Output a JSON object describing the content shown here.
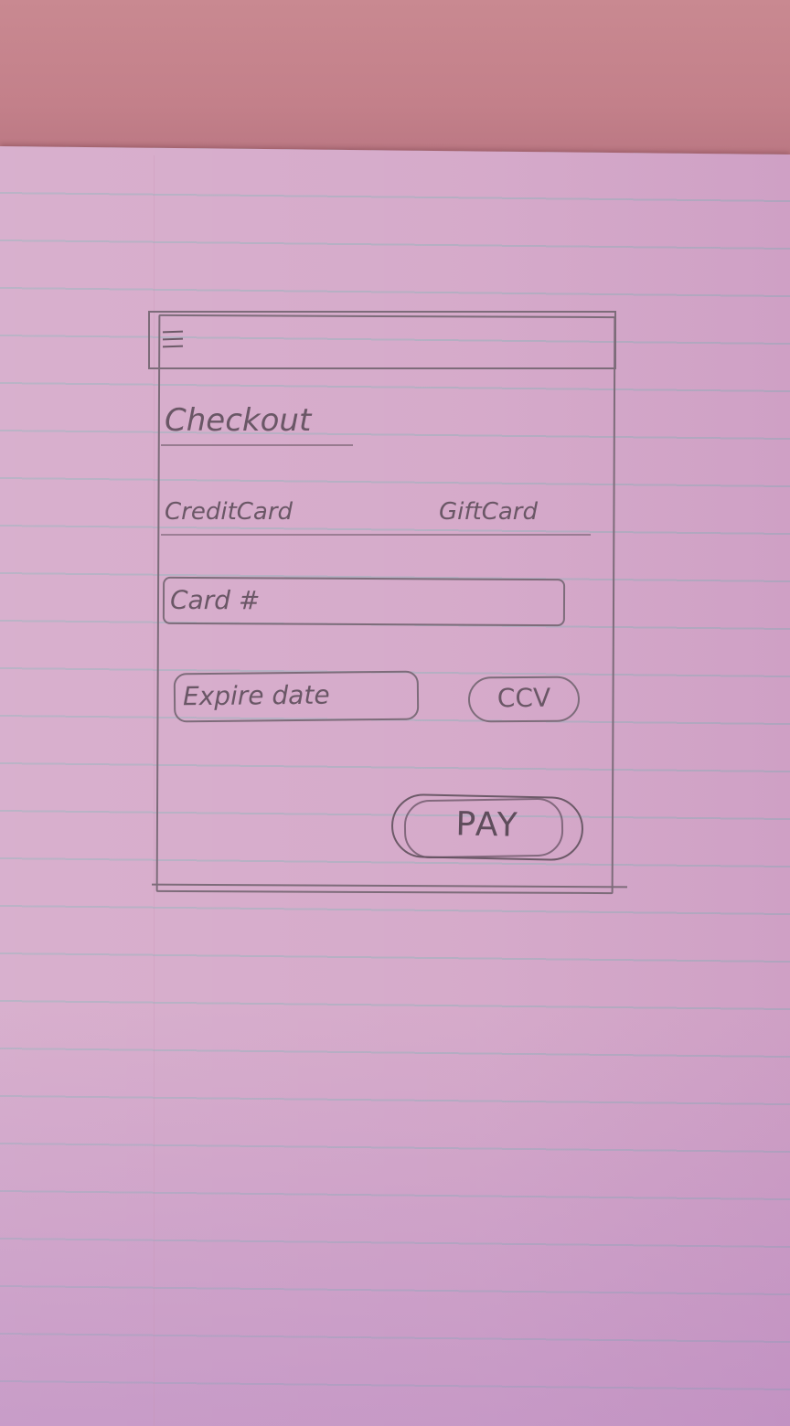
{
  "screen": {
    "title": "Checkout",
    "tabs": [
      {
        "label": "CreditCard"
      },
      {
        "label": "GiftCard"
      }
    ],
    "fields": {
      "card_number": {
        "label": "Card #"
      },
      "expire_date": {
        "label": "Expire date"
      },
      "ccv": {
        "label": "CCV"
      }
    },
    "pay_button": {
      "label": "PAY"
    },
    "menu_icon": "hamburger-menu-icon"
  },
  "colors": {
    "paper": "#d4a7c8",
    "table": "#c3808a",
    "pencil": "#6c5a68",
    "ruled_line": "#96afb9"
  }
}
